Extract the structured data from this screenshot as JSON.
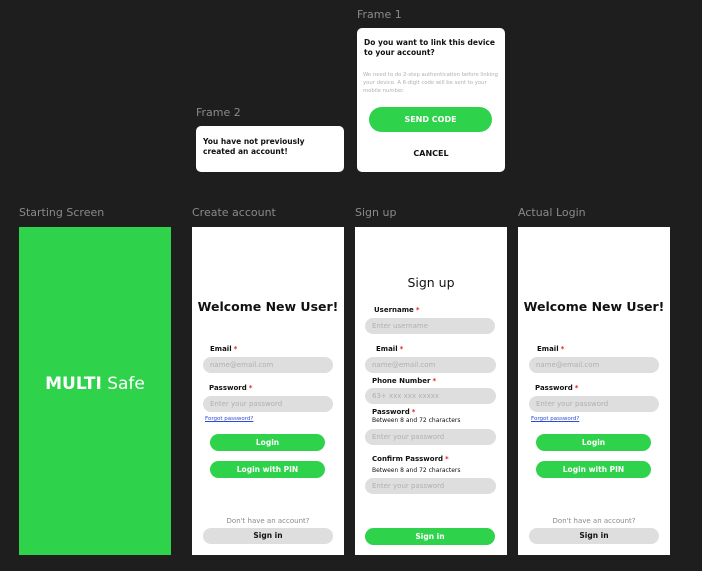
{
  "frame_labels": {
    "frame1": "Frame 1",
    "frame2": "Frame 2",
    "starting": "Starting Screen",
    "create": "Create account",
    "signup": "Sign up",
    "login": "Actual Login"
  },
  "frame1": {
    "title": "Do you want to link this device to your account?",
    "description": "We need to do 2-step authentication before linking your device. A 6-digit code will be sent to your mobile number.",
    "send_button": "SEND CODE",
    "cancel_button": "CANCEL"
  },
  "frame2": {
    "message": "You have not previously created an account!"
  },
  "starting_screen": {
    "brand_bold": "MULTI",
    "brand_light": "Safe"
  },
  "create_account": {
    "title": "Welcome New User!",
    "email_label": "Email",
    "email_placeholder": "name@email.com",
    "password_label": "Password",
    "password_placeholder": "Enter your password",
    "forgot": "Forgot password?",
    "login_button": "Login",
    "pin_button": "Login with PIN",
    "no_account": "Don't have an account?",
    "signin_button": "Sign in"
  },
  "signup": {
    "title": "Sign up",
    "username_label": "Username",
    "username_placeholder": "Enter username",
    "email_label": "Email",
    "email_placeholder": "name@email.com",
    "phone_label": "Phone Number",
    "phone_placeholder": "63+ xxx xxx xxxxx",
    "password_label": "Password",
    "password_hint": "Between 8 and 72 characters",
    "password_placeholder": "Enter your password",
    "confirm_label": "Confirm Password",
    "confirm_hint": "Between 8 and 72 characters",
    "confirm_placeholder": "Enter your password",
    "signin_button": "Sign in"
  },
  "actual_login": {
    "title": "Welcome New User!",
    "email_label": "Email",
    "email_placeholder": "name@email.com",
    "password_label": "Password",
    "password_placeholder": "Enter your password",
    "forgot": "Forgot password?",
    "login_button": "Login",
    "pin_button": "Login with PIN",
    "no_account": "Don't have an account?",
    "signin_button": "Sign in"
  },
  "colors": {
    "canvas": "#1e1e1e",
    "accent_green": "#2fd24b",
    "input_gray": "#dedede",
    "required_red": "#e0242b",
    "link_blue": "#2d4bd8"
  }
}
